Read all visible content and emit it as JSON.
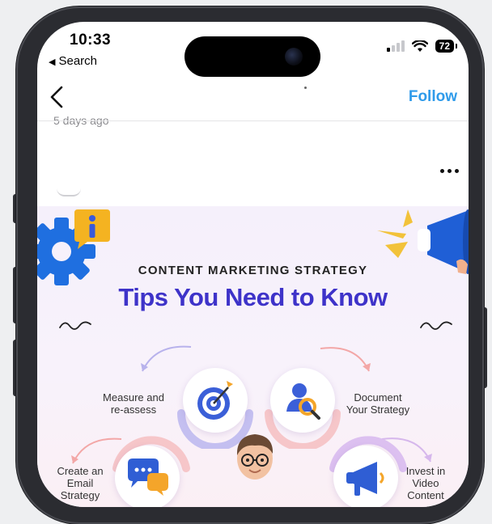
{
  "status_bar": {
    "time": "10:33",
    "back_app_label": "Search",
    "battery": "72"
  },
  "nav": {
    "follow_label": "Follow"
  },
  "post_meta": {
    "posted_ago": "5 days ago"
  },
  "post_image": {
    "kicker": "CONTENT MARKETING STRATEGY",
    "headline": "Tips You Need to Know",
    "tips": [
      {
        "label_line1": "Measure and",
        "label_line2": "re-assess",
        "label_line3": ""
      },
      {
        "label_line1": "Document",
        "label_line2": "Your Strategy",
        "label_line3": ""
      },
      {
        "label_line1": "Create an",
        "label_line2": "Email",
        "label_line3": "Strategy"
      },
      {
        "label_line1": "Invest in",
        "label_line2": "Video",
        "label_line3": "Content"
      }
    ]
  },
  "colors": {
    "accent_follow": "#2f9bea",
    "headline": "#3e33c9",
    "gear": "#1f6fe0",
    "megaphone": "#1f5fd6",
    "info_badge": "#f4b321"
  }
}
